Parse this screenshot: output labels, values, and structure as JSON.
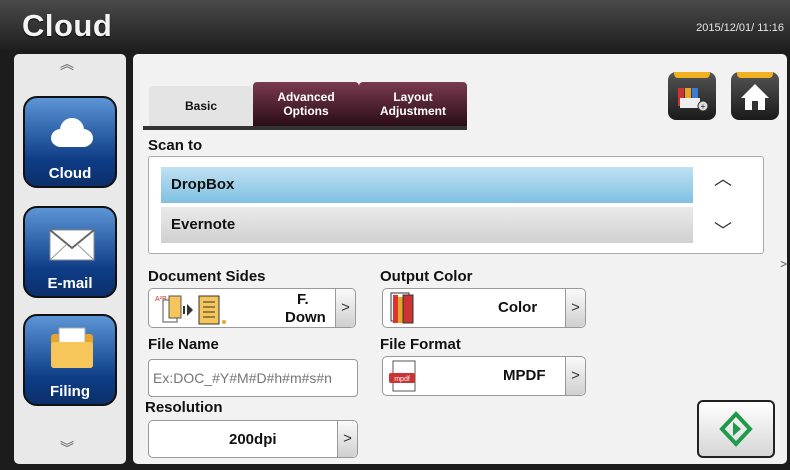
{
  "header": {
    "title": "Cloud",
    "datetime": "2015/12/01/ 11:16"
  },
  "sidebar": {
    "items": [
      {
        "label": "Cloud",
        "icon": "cloud-icon"
      },
      {
        "label": "E-mail",
        "icon": "envelope-icon"
      },
      {
        "label": "Filing",
        "icon": "folder-icon"
      }
    ]
  },
  "tabs": [
    {
      "label": "Basic"
    },
    {
      "label": "Advanced\nOptions"
    },
    {
      "label": "Layout\nAdjustment"
    }
  ],
  "scan_to": {
    "label": "Scan to",
    "items": [
      "DropBox",
      "Evernote"
    ],
    "selected": "DropBox"
  },
  "document_sides": {
    "label": "Document Sides",
    "value_line1": "F.",
    "value_line2": "Down"
  },
  "output_color": {
    "label": "Output Color",
    "value": "Color"
  },
  "file_name": {
    "label": "File Name",
    "placeholder": "Ex:DOC_#Y#M#D#h#m#s#n"
  },
  "file_format": {
    "label": "File Format",
    "value": "MPDF",
    "icon_text": "mpdf"
  },
  "resolution": {
    "label": "Resolution",
    "value": "200dpi"
  },
  "colors": {
    "accent_blue": "#7fc1e2",
    "tab_dark": "#5a1f2e",
    "sidebar_button": "#0e3d86",
    "start_green": "#1f9a4a"
  }
}
